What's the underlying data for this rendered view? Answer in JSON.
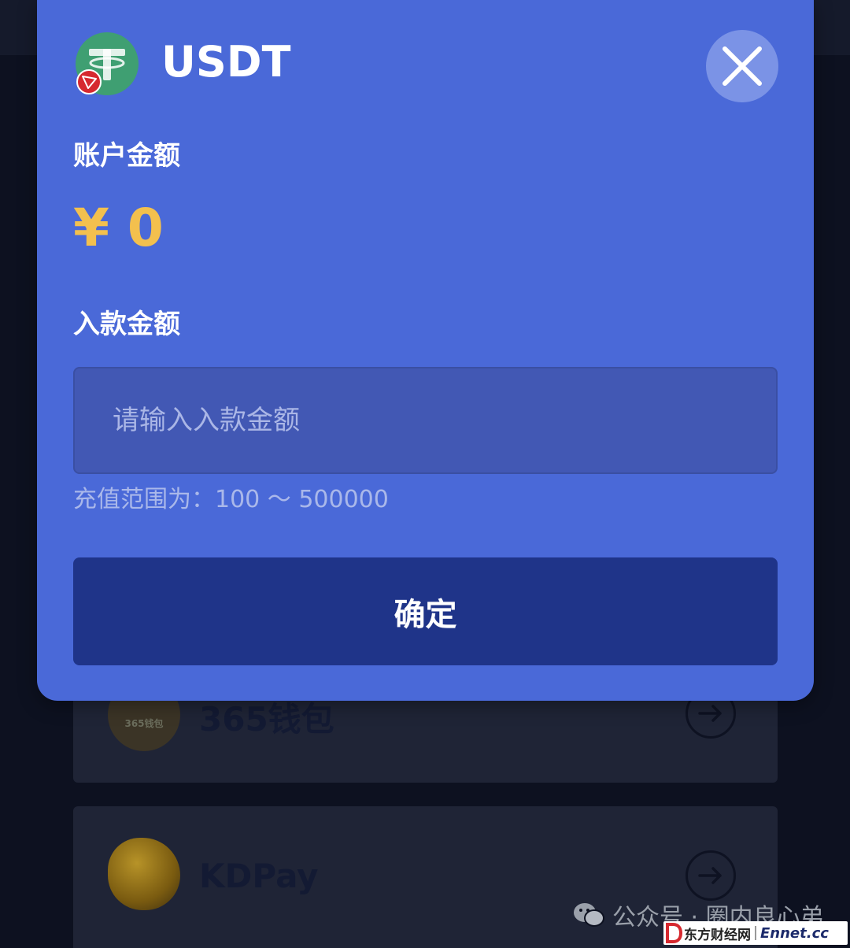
{
  "modal": {
    "coin_name": "USDT",
    "balance_label": "账户金额",
    "balance_value": "¥ 0",
    "deposit_label": "入款金额",
    "amount_placeholder": "请输入入款金额",
    "range_hint": "充值范围为：100 ～ 500000",
    "confirm_label": "确定"
  },
  "payment_methods": [
    {
      "name": "365钱包",
      "logo_text": "365钱包"
    },
    {
      "name": "KDPay"
    }
  ],
  "watermark": {
    "wechat_text": "公众号 · 圈内良心弟",
    "site_cn": "东方财经网",
    "site_en": "Ennet.cc"
  },
  "colors": {
    "modal_bg": "#4a69d8",
    "confirm_bg": "#1f3489",
    "balance_accent": "#f3c04e",
    "tether_green": "#3f9f72",
    "tron_red": "#d6292f"
  },
  "icons": {
    "coin": "tether-icon",
    "network_badge": "tron-badge-icon",
    "close": "close-icon",
    "row_action": "arrow-right-circle-icon"
  }
}
